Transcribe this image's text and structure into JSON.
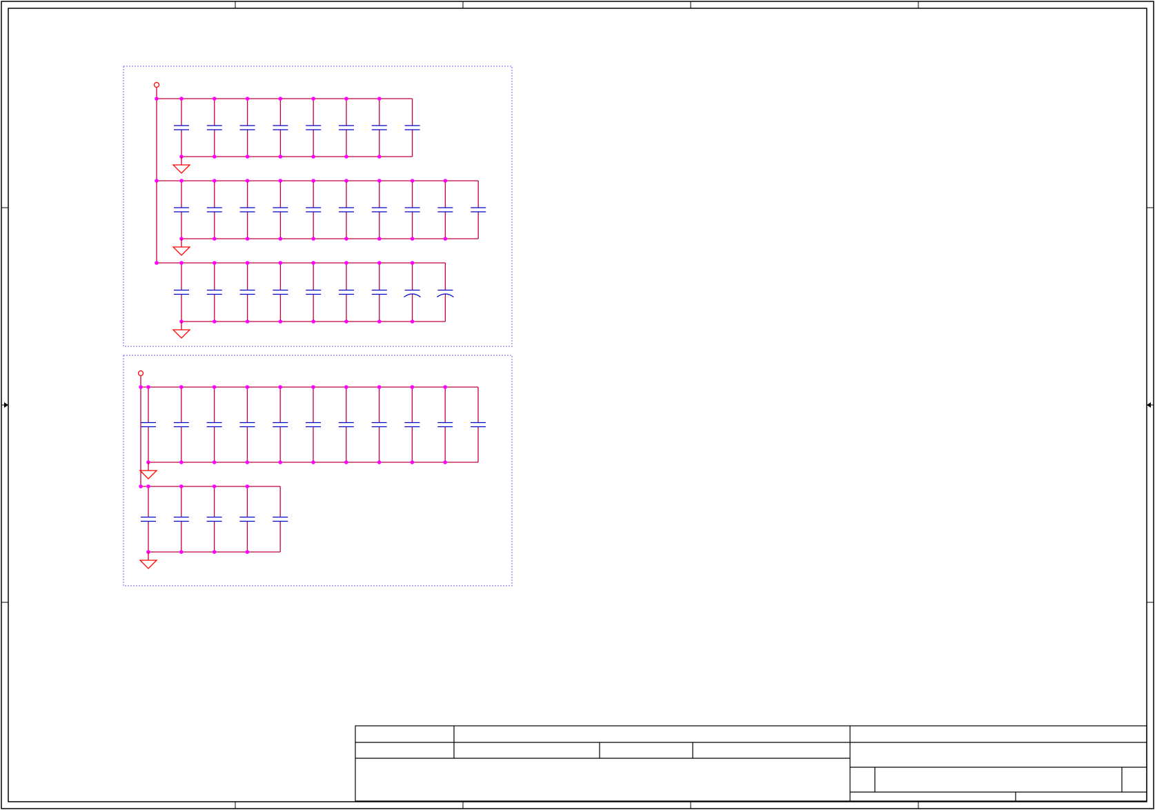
{
  "sheet": {
    "title": "",
    "frame_color": "#000000",
    "wire_color": "#c0003c",
    "junction_color": "#ff00ff",
    "capacitor_color": "#0000cc",
    "power_color": "#ff0000",
    "group_border_color": "#6666ff"
  },
  "groups": [
    {
      "name": "decoupling-group-1",
      "power_ports": 1,
      "rows": [
        {
          "capacitors": 8,
          "polarized_from": null
        },
        {
          "capacitors": 10,
          "polarized_from": null
        },
        {
          "capacitors": 9,
          "polarized_from": 7
        }
      ]
    },
    {
      "name": "decoupling-group-2",
      "power_ports": 1,
      "rows": [
        {
          "capacitors": 11,
          "polarized_from": null
        },
        {
          "capacitors": 5,
          "polarized_from": null
        }
      ]
    }
  ],
  "title_block": {
    "cells": [
      "",
      "",
      "",
      "",
      "",
      "",
      "",
      "",
      "",
      "",
      "",
      ""
    ]
  }
}
